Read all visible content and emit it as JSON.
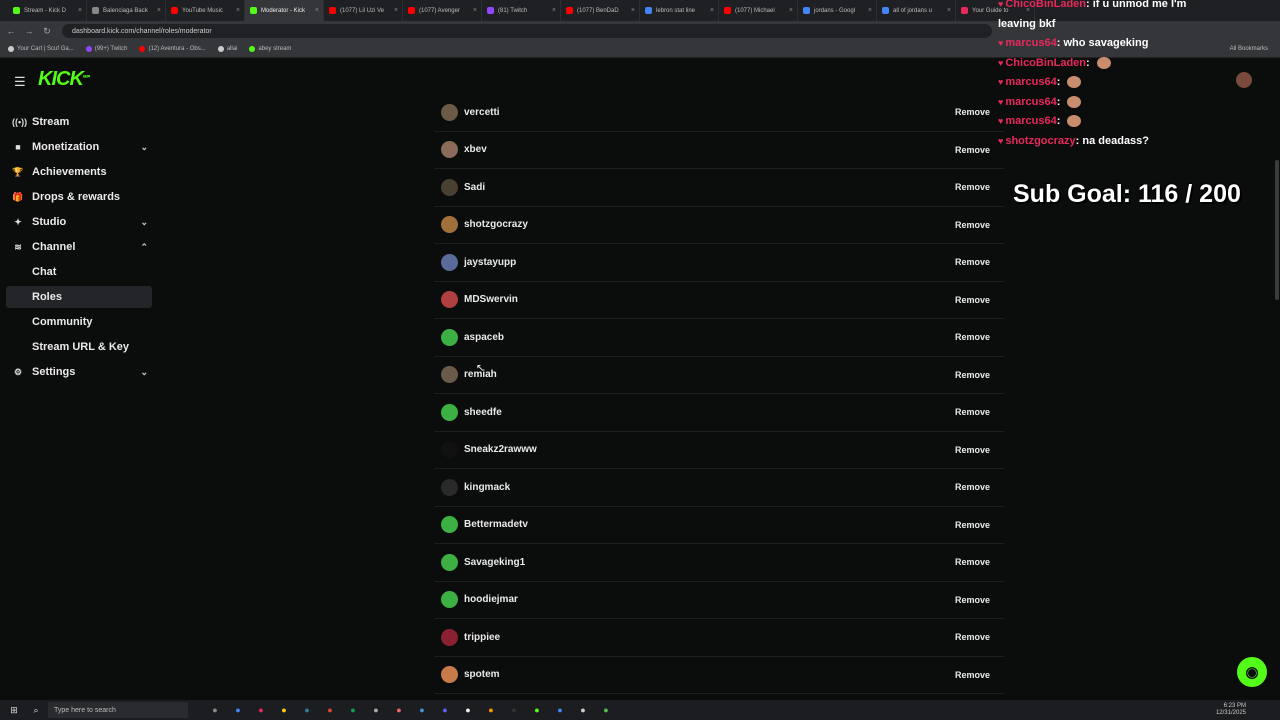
{
  "browser": {
    "tabs": [
      {
        "label": "Stream - Kick D",
        "color": "#53fc18"
      },
      {
        "label": "Balenciaga Back",
        "color": "#888888"
      },
      {
        "label": "YouTube Music",
        "color": "#ff0000"
      },
      {
        "label": "Moderator - Kick",
        "color": "#53fc18",
        "active": true
      },
      {
        "label": "(1077) Lil Uzi Ve",
        "color": "#ff0000"
      },
      {
        "label": "(1077) Avenger",
        "color": "#ff0000"
      },
      {
        "label": "(81) Twitch",
        "color": "#9146ff"
      },
      {
        "label": "(1077) BenDaD",
        "color": "#ff0000"
      },
      {
        "label": "lebron stat line",
        "color": "#4285f4"
      },
      {
        "label": "(1077) Michael",
        "color": "#ff0000"
      },
      {
        "label": "jordans - Googl",
        "color": "#4285f4"
      },
      {
        "label": "all of jordans u",
        "color": "#4285f4"
      },
      {
        "label": "Your Guide to",
        "color": "#e8295b"
      }
    ],
    "url": "dashboard.kick.com/channel/roles/moderator",
    "bookmarks": [
      {
        "label": "Your Cart | Scuf Ga...",
        "color": "#cccccc"
      },
      {
        "label": "(99+) Twitch",
        "color": "#9146ff"
      },
      {
        "label": "(12) Aventura - Obs...",
        "color": "#ff0000"
      },
      {
        "label": "allai",
        "color": "#cccccc"
      },
      {
        "label": "abey stream",
        "color": "#53fc18"
      }
    ],
    "bookmarks_right": "All Bookmarks"
  },
  "app": {
    "logo": "KICK",
    "logo_beta": "BETA",
    "accent": "#53fc18"
  },
  "sidebar": {
    "items": [
      {
        "label": "Stream",
        "icon": "broadcast-icon",
        "glyph": "((•))",
        "chevron": ""
      },
      {
        "label": "Monetization",
        "icon": "money-icon",
        "glyph": "■",
        "chevron": "⌄"
      },
      {
        "label": "Achievements",
        "icon": "trophy-icon",
        "glyph": "🏆",
        "chevron": ""
      },
      {
        "label": "Drops & rewards",
        "icon": "gift-icon",
        "glyph": "🎁",
        "chevron": ""
      },
      {
        "label": "Studio",
        "icon": "studio-icon",
        "glyph": "✦",
        "chevron": "⌄"
      },
      {
        "label": "Channel",
        "icon": "channel-icon",
        "glyph": "≋",
        "chevron": "⌃"
      }
    ],
    "subitems": [
      "Chat",
      "Roles",
      "Community",
      "Stream URL & Key"
    ],
    "selected": "Roles",
    "settings": {
      "label": "Settings",
      "icon": "gear-icon",
      "chevron": "⌄"
    }
  },
  "moderators": {
    "remove_label": "Remove",
    "rows": [
      {
        "name": "vercetti",
        "avatar": "#6b5a45"
      },
      {
        "name": "xbev",
        "avatar": "#8b6a5a"
      },
      {
        "name": "Sadi",
        "avatar": "#4a4032"
      },
      {
        "name": "shotzgocrazy",
        "avatar": "#a0703a"
      },
      {
        "name": "jaystayupp",
        "avatar": "#5a6a9a"
      },
      {
        "name": "MDSwervin",
        "avatar": "#b04040"
      },
      {
        "name": "aspaceb",
        "avatar": "#3cb043"
      },
      {
        "name": "remiah",
        "avatar": "#6a5a4a"
      },
      {
        "name": "sheedfe",
        "avatar": "#3cb043"
      },
      {
        "name": "Sneakz2rawww",
        "avatar": "#111111"
      },
      {
        "name": "kingmack",
        "avatar": "#2a2a2a"
      },
      {
        "name": "Bettermadetv",
        "avatar": "#3cb043"
      },
      {
        "name": "Savageking1",
        "avatar": "#3cb043"
      },
      {
        "name": "hoodiejmar",
        "avatar": "#3cb043"
      },
      {
        "name": "trippiee",
        "avatar": "#8a2030"
      },
      {
        "name": "spotem",
        "avatar": "#c87a4a"
      }
    ]
  },
  "overlay": {
    "chat": [
      {
        "user": "ChicoBinLaden",
        "msg": "if u unmod me I'm"
      },
      {
        "user": "",
        "msg": "leaving bkf"
      },
      {
        "user": "marcus64",
        "msg": "who savageking"
      },
      {
        "user": "ChicoBinLaden",
        "msg": ""
      },
      {
        "user": "marcus64",
        "msg": ""
      },
      {
        "user": "marcus64",
        "msg": ""
      },
      {
        "user": "marcus64",
        "msg": ""
      },
      {
        "user": "shotzgocrazy",
        "msg": "na deadass?"
      }
    ],
    "sub_goal": "Sub Goal:  116 / 200"
  },
  "taskbar": {
    "search_placeholder": "Type here to search",
    "time": "6:23 PM",
    "date": "12/31/2025"
  }
}
